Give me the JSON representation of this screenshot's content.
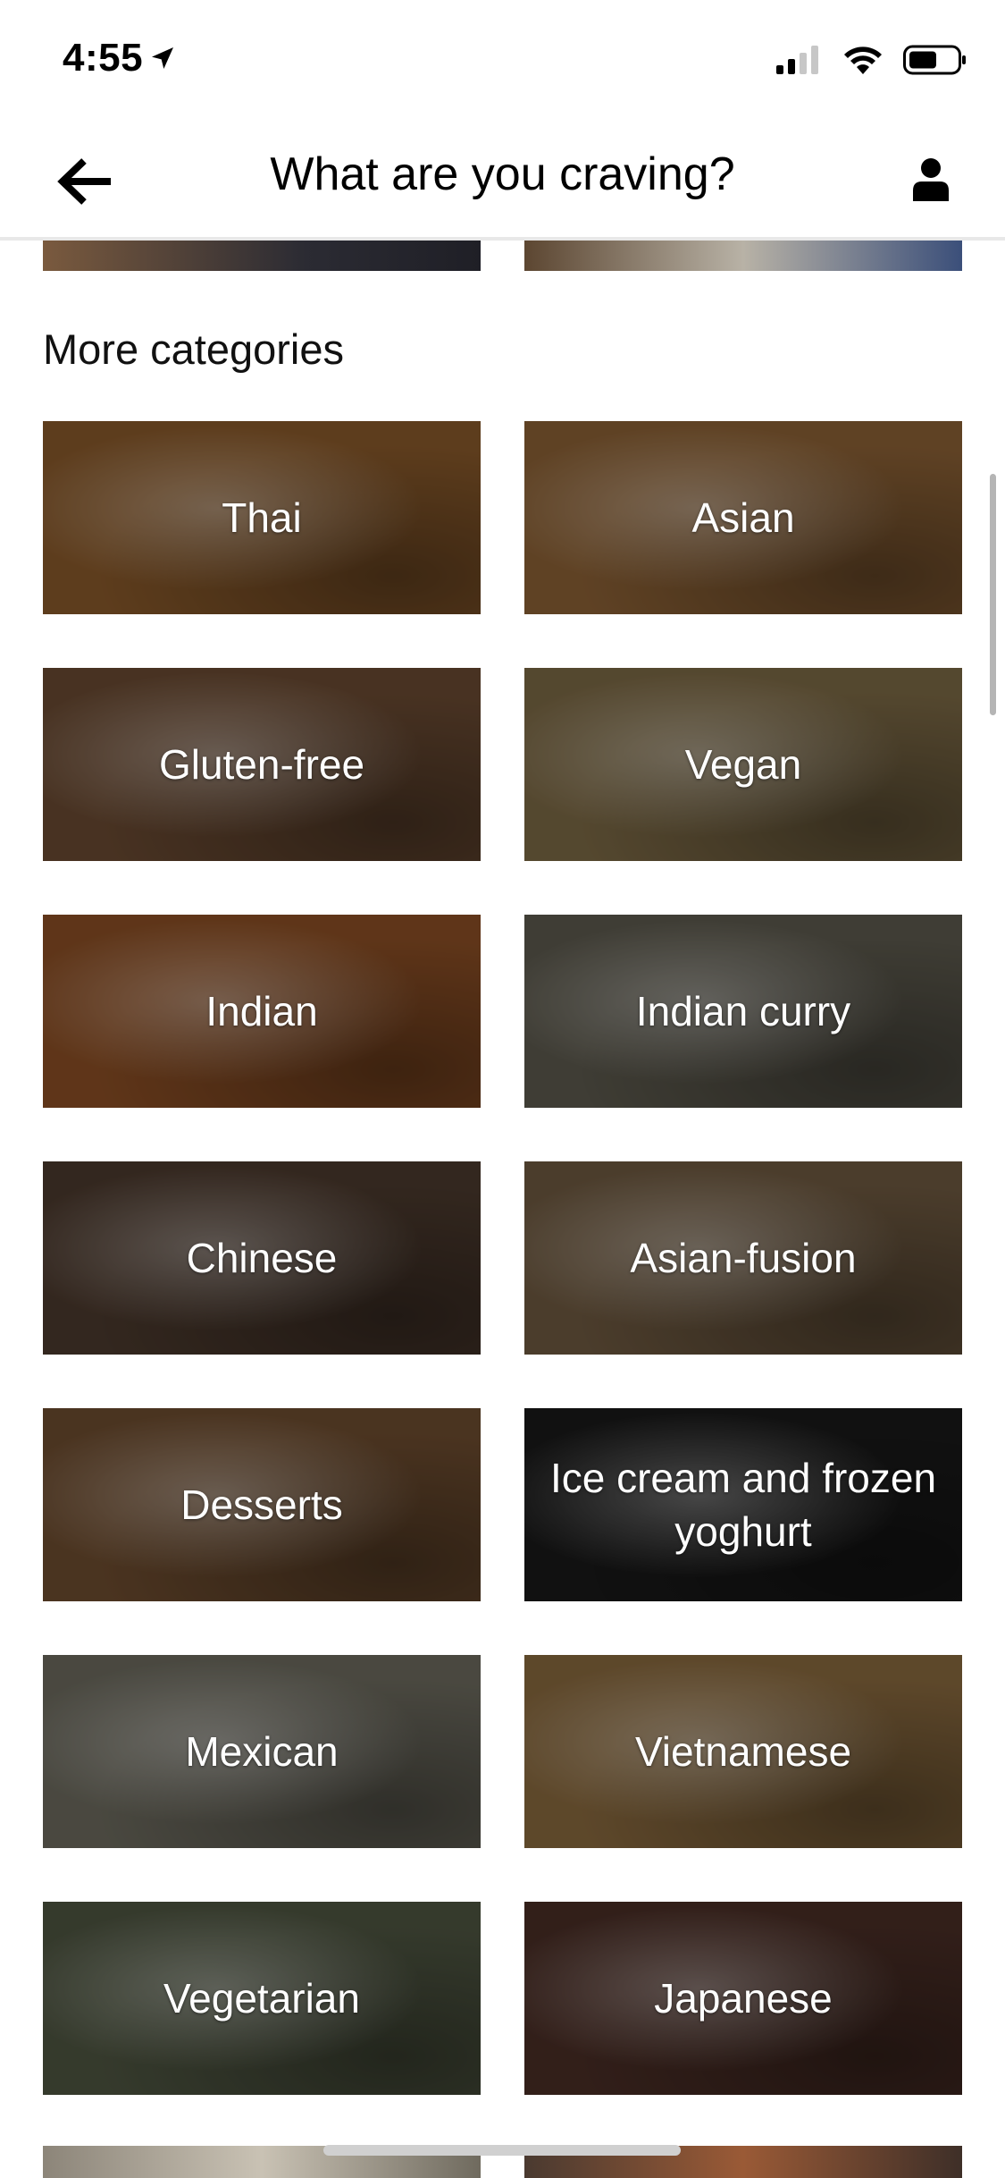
{
  "status_bar": {
    "time": "4:55"
  },
  "nav": {
    "title": "What are you craving?"
  },
  "section": {
    "heading": "More categories"
  },
  "categories": [
    {
      "label": "Thai",
      "color": "#8a5a2b"
    },
    {
      "label": "Asian",
      "color": "#8d6236"
    },
    {
      "label": "Gluten-free",
      "color": "#6b4b33"
    },
    {
      "label": "Vegan",
      "color": "#7d6a46"
    },
    {
      "label": "Indian",
      "color": "#8c4f25"
    },
    {
      "label": "Indian curry",
      "color": "#5d5a4e"
    },
    {
      "label": "Chinese",
      "color": "#4c3a2e"
    },
    {
      "label": "Asian-fusion",
      "color": "#6f5a41"
    },
    {
      "label": "Desserts",
      "color": "#6e4d30"
    },
    {
      "label": "Ice cream and frozen yoghurt",
      "color": "#1a1a1a"
    },
    {
      "label": "Mexican",
      "color": "#6d6b5f"
    },
    {
      "label": "Vietnamese",
      "color": "#8a6a3f"
    },
    {
      "label": "Vegetarian",
      "color": "#4f5642"
    },
    {
      "label": "Japanese",
      "color": "#4a2e26"
    }
  ]
}
